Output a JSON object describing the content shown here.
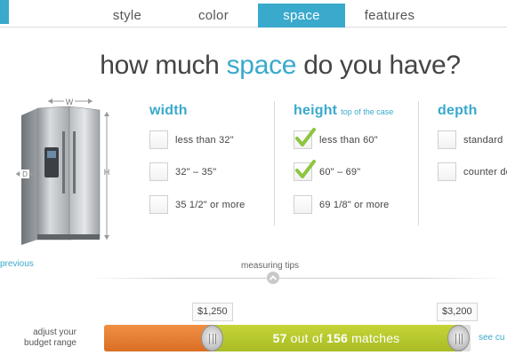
{
  "tabs": [
    {
      "label": "style",
      "active": false
    },
    {
      "label": "color",
      "active": false
    },
    {
      "label": "space",
      "active": true
    },
    {
      "label": "features",
      "active": false
    }
  ],
  "heading": {
    "prefix": "how much ",
    "accent": "space",
    "suffix": " do you have?"
  },
  "fridge": {
    "width_label": "W",
    "height_label": "H",
    "depth_label": "D"
  },
  "columns": {
    "width": {
      "title": "width",
      "subtitle": "",
      "options": [
        {
          "label": "less than 32\"",
          "checked": false
        },
        {
          "label": "32\" – 35\"",
          "checked": false
        },
        {
          "label": "35 1/2\" or more",
          "checked": false
        }
      ]
    },
    "height": {
      "title": "height",
      "subtitle": "top of the case",
      "options": [
        {
          "label": "less than 60\"",
          "checked": true
        },
        {
          "label": "60\" – 69\"",
          "checked": true
        },
        {
          "label": "69 1/8\" or more",
          "checked": false
        }
      ]
    },
    "depth": {
      "title": "depth",
      "subtitle": "",
      "options": [
        {
          "label": "standard",
          "checked": false
        },
        {
          "label": "counter de",
          "checked": false
        }
      ]
    }
  },
  "links": {
    "previous": "previous",
    "measuring_tips": "measuring tips",
    "see": "see cu"
  },
  "budget": {
    "label_line1": "adjust your",
    "label_line2": "budget range",
    "min_price": "$1,250",
    "max_price": "$3,200",
    "match_count": "57",
    "match_total": "156",
    "match_of": " out of ",
    "match_suffix": " matches"
  },
  "colors": {
    "accent": "#39a9cc",
    "budget_excluded": "#e58131",
    "budget_selected": "#b7c92d",
    "check": "#8cc63f"
  }
}
